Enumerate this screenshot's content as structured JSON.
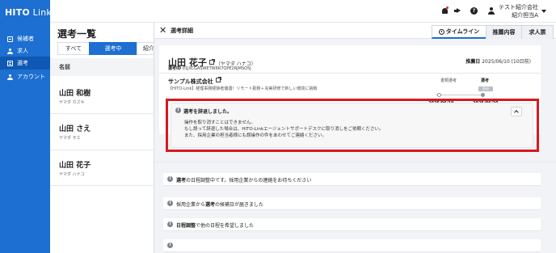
{
  "app": {
    "logo_main": "HITO",
    "logo_sub": " Link"
  },
  "sidebar": {
    "items": [
      {
        "label": "候補者",
        "icon": "id-card-icon"
      },
      {
        "label": "求人",
        "icon": "person-icon"
      },
      {
        "label": "選考",
        "icon": "document-icon",
        "active": true
      },
      {
        "label": "アカウント",
        "icon": "account-icon"
      }
    ]
  },
  "list": {
    "title": "選考一覧",
    "tabs": [
      "すべて",
      "選考中",
      "紹介"
    ],
    "active_tab": "選考中",
    "column_header": "名前",
    "candidates": [
      {
        "name": "山田 和樹",
        "kana": "ヤマダ カズキ"
      },
      {
        "name": "山田 さえ",
        "kana": "ヤマダ サエ"
      },
      {
        "name": "山田 花子",
        "kana": "ヤマダ ハナコ"
      }
    ]
  },
  "header": {
    "company": "テスト紹介会社",
    "user": "紹介担当A",
    "help_label": "?"
  },
  "drawer": {
    "close_label": "✕",
    "title": "選考詳細",
    "tabs": [
      "タイムライン",
      "推薦内容",
      "求人票"
    ],
    "active_tab": "タイムライン",
    "candidate": {
      "name": "山田 花子",
      "kana": "（ヤマダ ハナコ）",
      "id_label": "選考ID",
      "id": "01JXCGASWETW6R7QPE2RJMSQ5J"
    },
    "recommend_date_label": "推薦日",
    "recommend_date": "2025/06/10 (10日前)",
    "company": "サンプル株式会社",
    "job": "【HITO-Link】経理事務経験者優遇！リモート勤務＋充実研修で新しい環境に挑戦",
    "stages": {
      "prev_label": "書類選考",
      "current_label": "選考",
      "badge": "辞退",
      "date1": "2025/06/19",
      "date2": "2025/06/20"
    },
    "alert": {
      "title": "選考を辞退しました。",
      "line1": "操作を取り消すことはできません。",
      "line2": "もし誤って辞退した場合は、HITO-Linkエージェントサポートデスクに取り消しをご依頼ください。",
      "line3": "また、採用企業の担当者様にも誤操作の件をあわせてご連絡ください。"
    },
    "timeline": [
      {
        "bold": "選考",
        "rest": "の日程調整中です。採用企業からの連絡をお待ちください"
      },
      {
        "pre": "採用企業から",
        "bold": "選考",
        "rest": "の候補日が届きました"
      },
      {
        "bold": "日程調整",
        "rest": "で他の日程を希望しました"
      }
    ]
  },
  "colors": {
    "brand": "#1d6fd1",
    "alert_border": "#d7191f"
  }
}
